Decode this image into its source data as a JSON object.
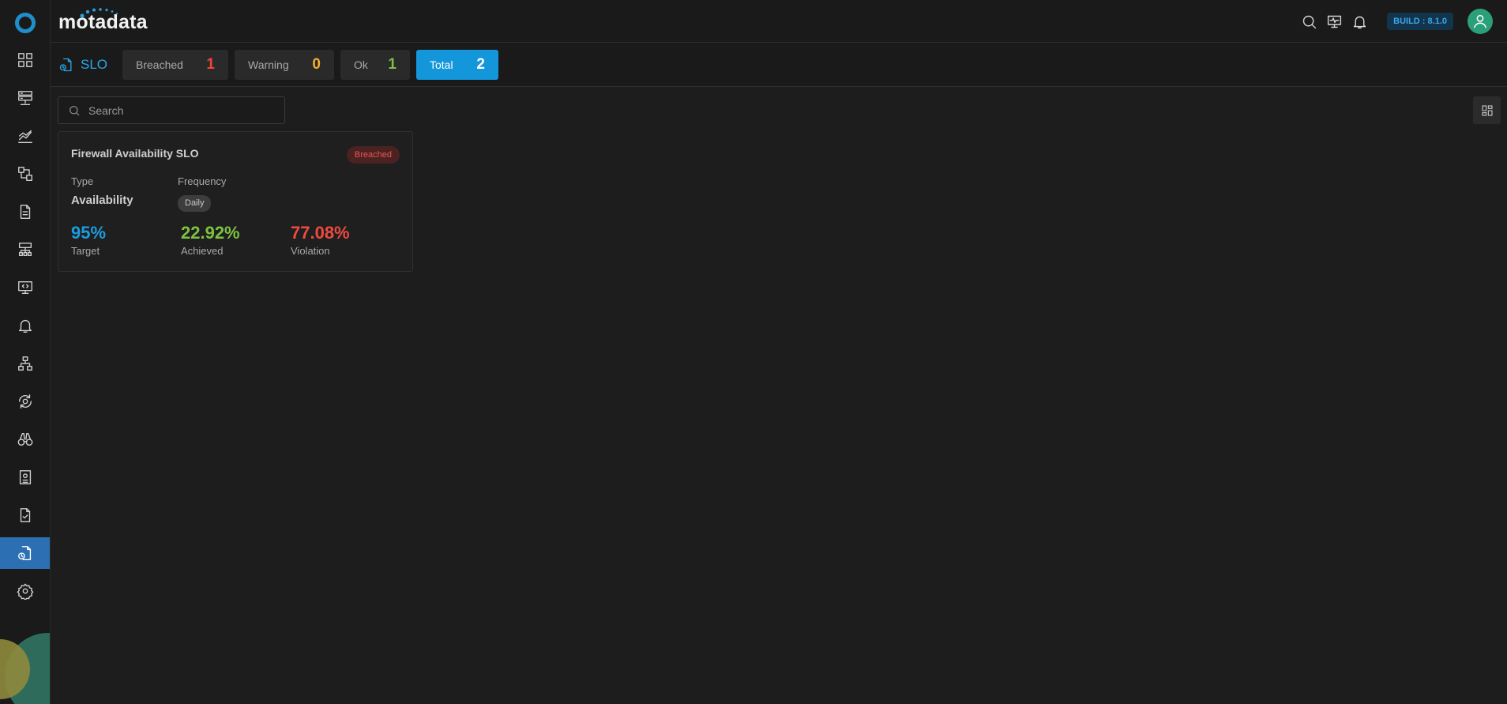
{
  "app": {
    "brand": "motadata"
  },
  "header": {
    "build": "BUILD : 8.1.0",
    "icons": [
      "search-icon",
      "monitor-pulse-icon",
      "bell-icon",
      "user-avatar-icon"
    ]
  },
  "sidebar": {
    "items": [
      {
        "name": "dashboard",
        "icon": "grid-icon"
      },
      {
        "name": "inventory",
        "icon": "server-icon"
      },
      {
        "name": "metrics",
        "icon": "chart-line-icon"
      },
      {
        "name": "flows",
        "icon": "flow-icon"
      },
      {
        "name": "reports",
        "icon": "document-icon"
      },
      {
        "name": "topology",
        "icon": "network-icon"
      },
      {
        "name": "apm",
        "icon": "monitor-code-icon"
      },
      {
        "name": "alerts",
        "icon": "bell-icon"
      },
      {
        "name": "hierarchy",
        "icon": "hierarchy-icon"
      },
      {
        "name": "automation",
        "icon": "gear-cycle-icon"
      },
      {
        "name": "explorer",
        "icon": "binoculars-icon"
      },
      {
        "name": "audit",
        "icon": "badge-document-icon"
      },
      {
        "name": "compliance",
        "icon": "checklist-icon"
      },
      {
        "name": "slo",
        "icon": "slo-icon",
        "active": true
      },
      {
        "name": "settings",
        "icon": "gear-icon"
      }
    ]
  },
  "subheader": {
    "title": "SLO",
    "counts": [
      {
        "label": "Breached",
        "value": "1"
      },
      {
        "label": "Warning",
        "value": "0"
      },
      {
        "label": "Ok",
        "value": "1"
      },
      {
        "label": "Total",
        "value": "2"
      }
    ]
  },
  "search": {
    "placeholder": "Search",
    "value": ""
  },
  "card": {
    "title": "Firewall Availability SLO",
    "status": "Breached",
    "type_label": "Type",
    "type_value": "Availability",
    "frequency_label": "Frequency",
    "frequency_value": "Daily",
    "metrics": [
      {
        "value": "95%",
        "caption": "Target"
      },
      {
        "value": "22.92%",
        "caption": "Achieved"
      },
      {
        "value": "77.08%",
        "caption": "Violation"
      }
    ]
  },
  "colors": {
    "accent": "#1496db",
    "breached": "#f0453a",
    "warning": "#f1b02e",
    "ok": "#7dc242"
  }
}
